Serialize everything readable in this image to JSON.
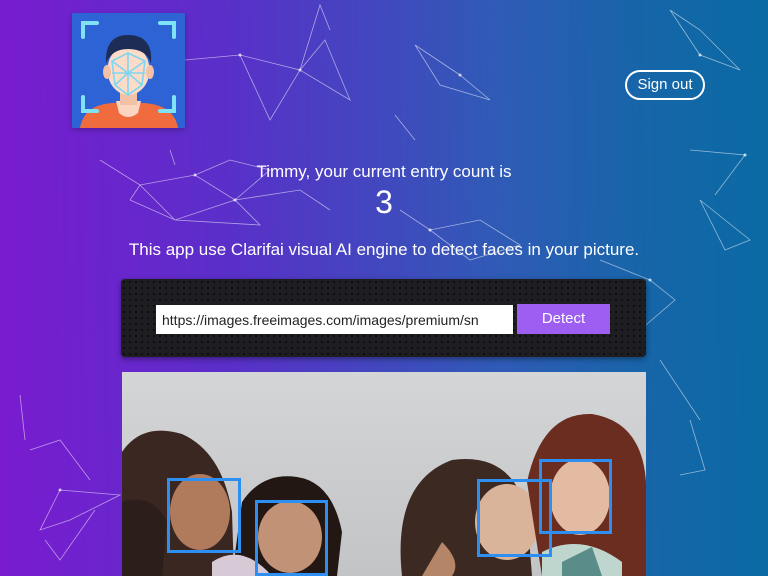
{
  "header": {
    "logo_icon": "face-recognition-icon",
    "signout_label": "Sign out"
  },
  "entry": {
    "message": "Timmy, your current entry count is",
    "count": "3"
  },
  "description": "This app use Clarifai visual AI engine to detect faces in your picture.",
  "form": {
    "url_value": "https://images.freeimages.com/images/premium/sn",
    "detect_label": "Detect"
  },
  "colors": {
    "accent": "#9d5ef1",
    "face_box": "#2d8ff2",
    "logo_bg": "#2e63d6"
  }
}
